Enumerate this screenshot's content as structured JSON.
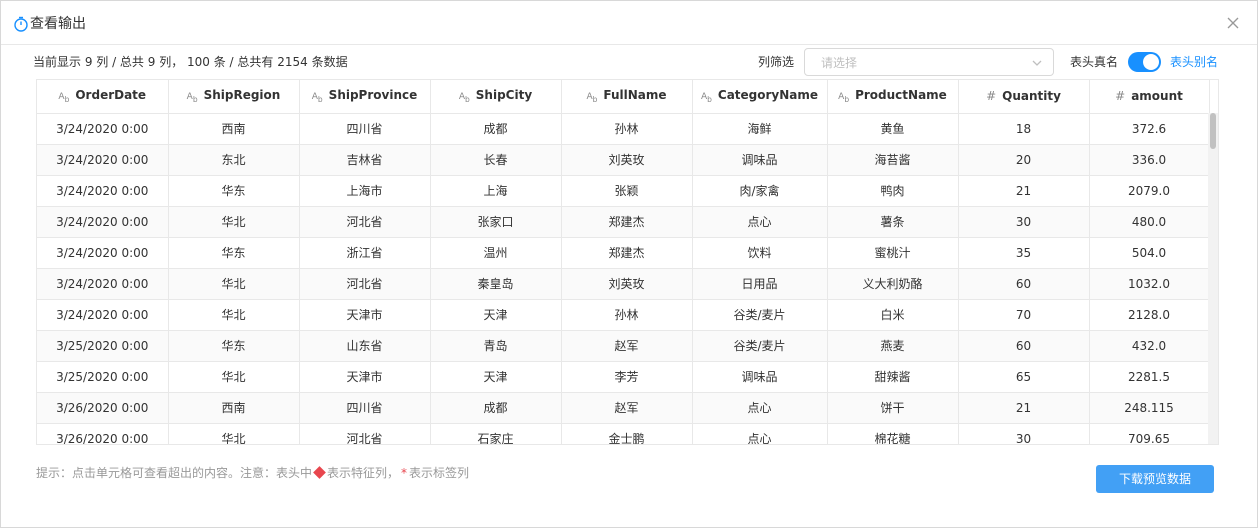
{
  "dialog": {
    "title": "查看输出",
    "close_icon": "close-icon",
    "title_icon": "stopwatch-icon"
  },
  "toolbar": {
    "summary": "当前显示 9 列 / 总共 9 列， 100 条 / 总共有 2154 条数据",
    "filter_label": "列筛选",
    "filter_placeholder": "请选择",
    "toggle_left_label": "表头真名",
    "toggle_right_label": "表头别名",
    "toggle_on": true,
    "accent_color": "#1890ff"
  },
  "table": {
    "columns": [
      {
        "type_icon": "A",
        "label": "OrderDate"
      },
      {
        "type_icon": "A",
        "label": "ShipRegion"
      },
      {
        "type_icon": "A",
        "label": "ShipProvince"
      },
      {
        "type_icon": "A",
        "label": "ShipCity"
      },
      {
        "type_icon": "A",
        "label": "FullName"
      },
      {
        "type_icon": "A",
        "label": "CategoryName"
      },
      {
        "type_icon": "A",
        "label": "ProductName"
      },
      {
        "type_icon": "#",
        "label": "Quantity"
      },
      {
        "type_icon": "#",
        "label": "amount"
      }
    ],
    "rows": [
      [
        "3/24/2020 0:00",
        "西南",
        "四川省",
        "成都",
        "孙林",
        "海鲜",
        "黄鱼",
        "18",
        "372.6"
      ],
      [
        "3/24/2020 0:00",
        "东北",
        "吉林省",
        "长春",
        "刘英玫",
        "调味品",
        "海苔酱",
        "20",
        "336.0"
      ],
      [
        "3/24/2020 0:00",
        "华东",
        "上海市",
        "上海",
        "张颖",
        "肉/家禽",
        "鸭肉",
        "21",
        "2079.0"
      ],
      [
        "3/24/2020 0:00",
        "华北",
        "河北省",
        "张家口",
        "郑建杰",
        "点心",
        "薯条",
        "30",
        "480.0"
      ],
      [
        "3/24/2020 0:00",
        "华东",
        "浙江省",
        "温州",
        "郑建杰",
        "饮料",
        "蜜桃汁",
        "35",
        "504.0"
      ],
      [
        "3/24/2020 0:00",
        "华北",
        "河北省",
        "秦皇岛",
        "刘英玫",
        "日用品",
        "义大利奶酪",
        "60",
        "1032.0"
      ],
      [
        "3/24/2020 0:00",
        "华北",
        "天津市",
        "天津",
        "孙林",
        "谷类/麦片",
        "白米",
        "70",
        "2128.0"
      ],
      [
        "3/25/2020 0:00",
        "华东",
        "山东省",
        "青岛",
        "赵军",
        "谷类/麦片",
        "燕麦",
        "60",
        "432.0"
      ],
      [
        "3/25/2020 0:00",
        "华北",
        "天津市",
        "天津",
        "李芳",
        "调味品",
        "甜辣酱",
        "65",
        "2281.5"
      ],
      [
        "3/26/2020 0:00",
        "西南",
        "四川省",
        "成都",
        "赵军",
        "点心",
        "饼干",
        "21",
        "248.115"
      ],
      [
        "3/26/2020 0:00",
        "华北",
        "河北省",
        "石家庄",
        "金士鹏",
        "点心",
        "棉花糖",
        "30",
        "709.65"
      ]
    ]
  },
  "footer": {
    "hint_prefix": "提示：点击单元格可查看超出的内容。注意：表头中",
    "hint_feature": "表示特征列，",
    "hint_star": "*",
    "hint_label": "表示标签列",
    "download_label": "下载预览数据",
    "download_color": "#42a0f5",
    "feature_color": "#e8464e"
  }
}
